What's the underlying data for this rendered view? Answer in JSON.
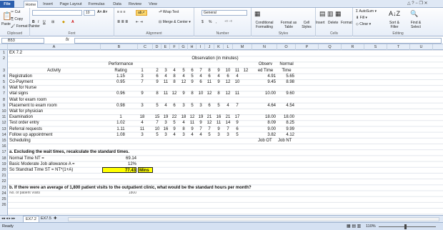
{
  "tabs": [
    "File",
    "Home",
    "Insert",
    "Page Layout",
    "Formulas",
    "Data",
    "Review",
    "View"
  ],
  "ribbon": {
    "clipboard": {
      "paste": "Paste",
      "cut": "Cut",
      "copy": "Copy",
      "format_painter": "Format Painter",
      "label": "Clipboard"
    },
    "font": {
      "size": "10",
      "label": "Font",
      "bold": "B",
      "italic": "I",
      "underline": "U"
    },
    "alignment": {
      "wrap": "Wrap Text",
      "merge": "Merge & Center",
      "label": "Alignment"
    },
    "number": {
      "format": "General",
      "currency": "$",
      "percent": "%",
      "comma": ",",
      "label": "Number"
    },
    "styles": {
      "conditional": "Conditional Formatting",
      "format_table": "Format as Table",
      "cell_styles": "Cell Styles",
      "label": "Styles"
    },
    "cells": {
      "insert": "Insert",
      "delete": "Delete",
      "format": "Format",
      "label": "Cells"
    },
    "editing": {
      "autosum": "AutoSum",
      "fill": "Fill",
      "clear": "Clear",
      "sort": "Sort & Filter",
      "find": "Find & Select",
      "label": "Editing"
    }
  },
  "formula_bar": {
    "name_box": "B53",
    "fx": "fx",
    "value": ""
  },
  "columns": [
    "A",
    "B",
    "C",
    "D",
    "E",
    "F",
    "G",
    "H",
    "I",
    "J",
    "K",
    "L",
    "M",
    "N",
    "O",
    "P",
    "Q",
    "R",
    "S",
    "T",
    "U"
  ],
  "rows": [
    "1",
    "2",
    "3",
    "4",
    "5",
    "6",
    "7",
    "8",
    "9",
    "10",
    "11",
    "12",
    "13",
    "14",
    "15",
    "16",
    "17",
    "18",
    "19",
    "20",
    "21",
    "22",
    "23",
    "24",
    "25",
    "26"
  ],
  "sheet": {
    "title": "EX 7.2",
    "perf_header1": "Performance",
    "perf_header2": "Rating",
    "obs_header": "Observation (in minutes)",
    "activity_header": "Activity",
    "obs_nums": [
      "1",
      "2",
      "3",
      "4",
      "5",
      "6",
      "7",
      "8",
      "9",
      "10",
      "11",
      "12"
    ],
    "observ_header1": "Observ",
    "observ_header2": "ed Time",
    "normal_header1": "Normal",
    "normal_header2": "Time",
    "activities": [
      {
        "name": "Registration",
        "rating": "1.15",
        "obs": [
          "3",
          "6",
          "4",
          "8",
          "4",
          "5",
          "4",
          "6",
          "4",
          "6",
          "4"
        ],
        "observed": "4.91",
        "normal": "5.65"
      },
      {
        "name": "Co-Payment",
        "rating": "0.95",
        "obs": [
          "7",
          "9",
          "11",
          "8",
          "12",
          "9",
          "6",
          "11",
          "9",
          "12",
          "10"
        ],
        "observed": "9.45",
        "normal": "8.98"
      },
      {
        "name": "Wait for Nurse",
        "rating": "",
        "obs": [],
        "observed": "",
        "normal": ""
      },
      {
        "name": "vital signs",
        "rating": "0.96",
        "obs": [
          "9",
          "8",
          "11",
          "12",
          "9",
          "8",
          "10",
          "12",
          "8",
          "12",
          "11"
        ],
        "observed": "10.00",
        "normal": "9.60"
      },
      {
        "name": "Wait for exam room",
        "rating": "",
        "obs": [],
        "observed": "",
        "normal": ""
      },
      {
        "name": "Placement to exam room",
        "rating": "0.98",
        "obs": [
          "3",
          "5",
          "4",
          "6",
          "3",
          "5",
          "3",
          "6",
          "5",
          "4",
          "7"
        ],
        "observed": "4.64",
        "normal": "4.54"
      },
      {
        "name": "Wait for physician",
        "rating": "",
        "obs": [],
        "observed": "",
        "normal": ""
      },
      {
        "name": "Examination",
        "rating": "1",
        "obs": [
          "18",
          "15",
          "19",
          "22",
          "18",
          "12",
          "19",
          "21",
          "16",
          "21",
          "17"
        ],
        "observed": "18.00",
        "normal": "18.00"
      },
      {
        "name": "Test order entry",
        "rating": "1.02",
        "obs": [
          "4",
          "7",
          "3",
          "5",
          "4",
          "11",
          "9",
          "12",
          "11",
          "14",
          "9"
        ],
        "observed": "8.09",
        "normal": "8.25"
      },
      {
        "name": "Referral requests",
        "rating": "1.11",
        "obs": [
          "11",
          "10",
          "16",
          "9",
          "8",
          "9",
          "7",
          "7",
          "9",
          "7",
          "6"
        ],
        "observed": "9.00",
        "normal": "9.99"
      },
      {
        "name": "Follow up  appointment",
        "rating": "1.08",
        "obs": [
          "3",
          "5",
          "3",
          "4",
          "3",
          "4",
          "4",
          "5",
          "3",
          "3",
          "5"
        ],
        "observed": "3.82",
        "normal": "4.12"
      },
      {
        "name": "Scheduling",
        "rating": "",
        "obs": [],
        "observed": "",
        "normal": ""
      }
    ],
    "job_ot": "Job OT",
    "job_nt": "Job NT",
    "part_a": "a. Excluding the wait times, recalculate the standard times.",
    "nt_label": "Normal Time NT =",
    "nt_value": "69.14",
    "allow_label": "Basic Moderate Job allowance A =",
    "allow_value": "12%",
    "st_label": "So Standrad Time ST = NT*(1+A)",
    "st_value": "77.43",
    "st_unit": "Mins",
    "part_b": "b. If there were an average of 1,800 patient visits to the outpatient clinic, what would be the standard hours per month?",
    "visits_label": "No. of patient Visits",
    "visits_value": "1800"
  },
  "sheet_tabs": [
    "EX7.2",
    "EX7.5"
  ],
  "status": {
    "ready": "Ready",
    "zoom": "110%"
  },
  "colors": {
    "highlight": "#ffff00",
    "file_tab": "#2b5fae"
  }
}
